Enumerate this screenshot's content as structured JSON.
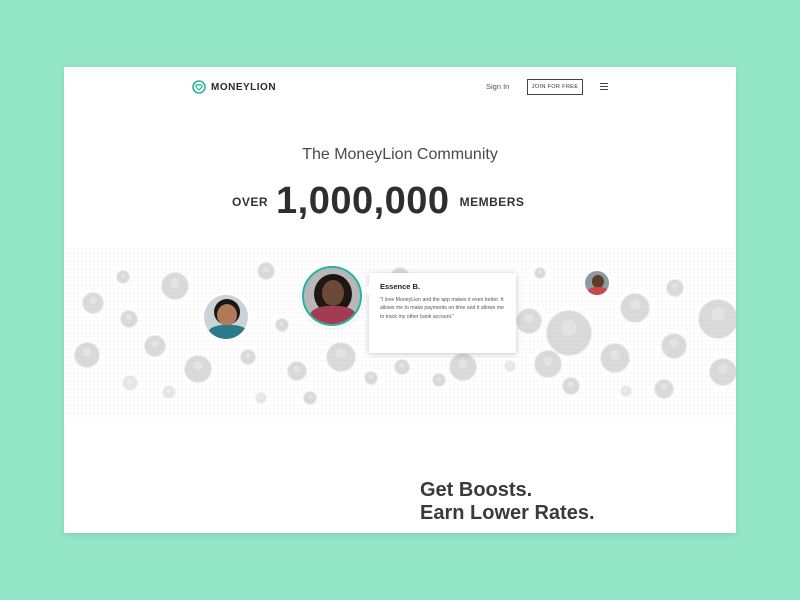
{
  "header": {
    "brand": "MONEYLION",
    "sign_in": "Sign In",
    "join_button": "JOIN FOR FREE",
    "menu_icon": "hamburger-menu-icon"
  },
  "hero": {
    "title": "The MoneyLion Community",
    "members_prefix": "OVER",
    "members_count": "1,000,000",
    "members_suffix": "MEMBERS"
  },
  "testimonial": {
    "name": "Essence B.",
    "quote": "\"I love MoneyLion and the app makes it even better. It allows me to make payments on time and it allows me to track my other bank account.\""
  },
  "bottom": {
    "line1": "Get Boosts.",
    "line2": "Earn Lower Rates."
  },
  "colors": {
    "background": "#94e6c9",
    "accent": "#28b4a0"
  }
}
